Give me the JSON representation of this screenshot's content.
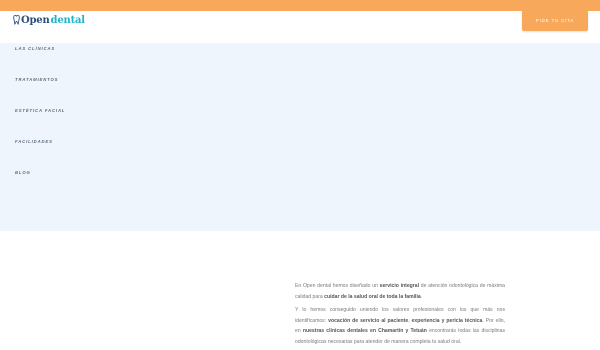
{
  "header": {
    "logo_word1": "Open",
    "logo_word2": "dental",
    "cta_label": "PIDE TU CITA"
  },
  "menu": {
    "items": [
      {
        "label": "LAS CLÍNICAS"
      },
      {
        "label": "TRATAMIENTOS"
      },
      {
        "label": "ESTÉTICA FACIAL"
      },
      {
        "label": "FACILIDADES"
      },
      {
        "label": "BLOG"
      }
    ]
  },
  "content": {
    "p1_a": "En Open dental hemos diseñado un ",
    "p1_b": "servicio integral",
    "p1_c": " de atención odontológica de máxima calidad para ",
    "p1_d": "cuidar de la salud oral de toda la familia",
    "p1_e": ".",
    "p2_a": "Y lo hemos conseguido uniendo los valores profesionales con los que más nos identificamos: ",
    "p2_b": "vocación de servicio al paciente",
    "p2_c": ", ",
    "p2_d": "experiencia y pericia técnica",
    "p2_e": ". Por ello, en ",
    "p2_f": "nuestras clínicas dentales en Chamartín y Tetuán",
    "p2_g": " encontrarás todas las disciplinas odontológicas necesarias para atender de manera completa tu salud oral."
  },
  "colors": {
    "accent": "#f7a85a",
    "menu_bg": "#eff5fd",
    "logo_dark": "#2b4f7a",
    "logo_teal": "#1fb3c8"
  }
}
